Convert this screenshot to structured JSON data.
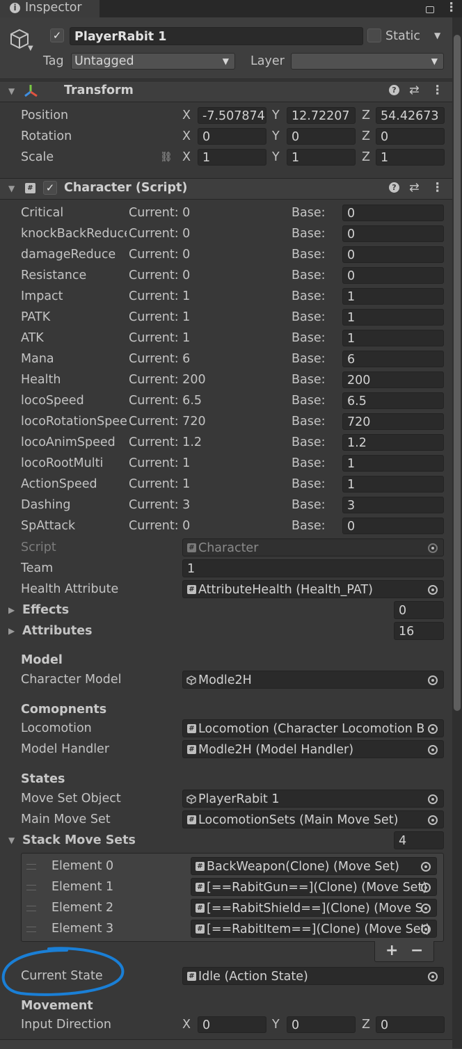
{
  "tab": {
    "title": "Inspector"
  },
  "object": {
    "name": "PlayerRabit 1",
    "static_label": "Static",
    "tag_label": "Tag",
    "tag_value": "Untagged",
    "layer_label": "Layer",
    "layer_value": ""
  },
  "transform": {
    "title": "Transform",
    "position": {
      "label": "Position",
      "x": "-7.507874",
      "y": "12.72207",
      "z": "54.42673"
    },
    "rotation": {
      "label": "Rotation",
      "x": "0",
      "y": "0",
      "z": "0"
    },
    "scale": {
      "label": "Scale",
      "x": "1",
      "y": "1",
      "z": "1"
    },
    "axes": {
      "x": "X",
      "y": "Y",
      "z": "Z"
    }
  },
  "character": {
    "title": "Character (Script)",
    "base_label": "Base:",
    "stats": [
      {
        "name": "Critical",
        "current": "Current: 0",
        "base": "0"
      },
      {
        "name": "knockBackReduce",
        "current": "Current: 0",
        "base": "0"
      },
      {
        "name": "damageReduce",
        "current": "Current: 0",
        "base": "0"
      },
      {
        "name": "Resistance",
        "current": "Current: 0",
        "base": "0"
      },
      {
        "name": "Impact",
        "current": "Current: 1",
        "base": "1"
      },
      {
        "name": "PATK",
        "current": "Current: 1",
        "base": "1"
      },
      {
        "name": "ATK",
        "current": "Current: 1",
        "base": "1"
      },
      {
        "name": "Mana",
        "current": "Current: 6",
        "base": "6"
      },
      {
        "name": "Health",
        "current": "Current: 200",
        "base": "200"
      },
      {
        "name": "locoSpeed",
        "current": "Current: 6.5",
        "base": "6.5"
      },
      {
        "name": "locoRotationSpeed",
        "current": "Current: 720",
        "base": "720"
      },
      {
        "name": "locoAnimSpeed",
        "current": "Current: 1.2",
        "base": "1.2"
      },
      {
        "name": "locoRootMulti",
        "current": "Current: 1",
        "base": "1"
      },
      {
        "name": "ActionSpeed",
        "current": "Current: 1",
        "base": "1"
      },
      {
        "name": "Dashing",
        "current": "Current: 3",
        "base": "3"
      },
      {
        "name": "SpAttack",
        "current": "Current: 0",
        "base": "0"
      }
    ],
    "script": {
      "label": "Script",
      "value": "Character"
    },
    "team": {
      "label": "Team",
      "value": "1"
    },
    "health_attribute": {
      "label": "Health Attribute",
      "value": "AttributeHealth (Health_PAT)"
    },
    "effects": {
      "label": "Effects",
      "count": "0"
    },
    "attributes": {
      "label": "Attributes",
      "count": "16"
    },
    "model_section": "Model",
    "character_model": {
      "label": "Character Model",
      "value": "Modle2H"
    },
    "components_section": "Comopnents",
    "locomotion": {
      "label": "Locomotion",
      "value": "Locomotion (Character Locomotion B"
    },
    "model_handler": {
      "label": "Model Handler",
      "value": "Modle2H (Model Handler)"
    },
    "states_section": "States",
    "move_set_object": {
      "label": "Move Set Object",
      "value": "PlayerRabit 1"
    },
    "main_move_set": {
      "label": "Main Move Set",
      "value": "LocomotionSets (Main Move Set)"
    },
    "stack_move_sets": {
      "label": "Stack Move Sets",
      "count": "4",
      "elements": [
        {
          "label": "Element 0",
          "value": "BackWeapon(Clone) (Move Set)"
        },
        {
          "label": "Element 1",
          "value": "[==RabitGun==](Clone) (Move Set)"
        },
        {
          "label": "Element 2",
          "value": "[==RabitShield==](Clone) (Move S"
        },
        {
          "label": "Element 3",
          "value": "[==RabitItem==](Clone) (Move Set)"
        }
      ],
      "add": "+",
      "remove": "−"
    },
    "current_state": {
      "label": "Current State",
      "value": "Idle (Action State)"
    },
    "movement_section": "Movement",
    "input_direction": {
      "label": "Input Direction",
      "x": "0",
      "y": "0",
      "z": "0"
    }
  },
  "colors": {
    "background": "#383838",
    "field": "#2a2a2a",
    "annotation": "#1a7fd6"
  }
}
